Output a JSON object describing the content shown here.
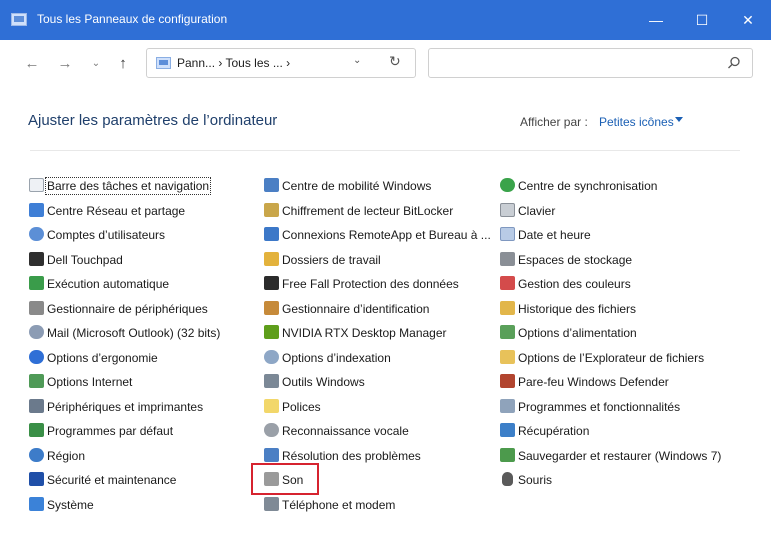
{
  "window": {
    "title": "Tous les Panneaux de configuration"
  },
  "nav": {
    "address": "Pann... › Tous les ... ›",
    "search_placeholder": ""
  },
  "header": {
    "title": "Ajuster les paramètres de l’ordinateur",
    "viewby_label": "Afficher par :",
    "viewby_value": "Petites icônes"
  },
  "columns": [
    [
      "Barre des tâches et navigation",
      "Centre Réseau et partage",
      "Comptes d’utilisateurs",
      "Dell Touchpad",
      "Exécution automatique",
      "Gestionnaire de périphériques",
      "Mail (Microsoft Outlook) (32 bits)",
      "Options d’ergonomie",
      "Options Internet",
      "Périphériques et imprimantes",
      "Programmes par défaut",
      "Région",
      "Sécurité et maintenance",
      "Système"
    ],
    [
      "Centre de mobilité Windows",
      "Chiffrement de lecteur BitLocker",
      "Connexions RemoteApp et Bureau à ...",
      "Dossiers de travail",
      "Free Fall Protection des données",
      "Gestionnaire d’identification",
      "NVIDIA RTX Desktop Manager",
      "Options d’indexation",
      "Outils Windows",
      "Polices",
      "Reconnaissance vocale",
      "Résolution des problèmes",
      "Son",
      "Téléphone et modem"
    ],
    [
      "Centre de synchronisation",
      "Clavier",
      "Date et heure",
      "Espaces de stockage",
      "Gestion des couleurs",
      "Historique des fichiers",
      "Options d’alimentation",
      "Options de l’Explorateur de fichiers",
      "Pare-feu Windows Defender",
      "Programmes et fonctionnalités",
      "Récupération",
      "Sauvegarder et restaurer (Windows 7)",
      "Souris"
    ]
  ],
  "colors": {
    "titlebar": "#2f6fd6",
    "link": "#1a5fb4",
    "highlight": "#d6232f"
  }
}
